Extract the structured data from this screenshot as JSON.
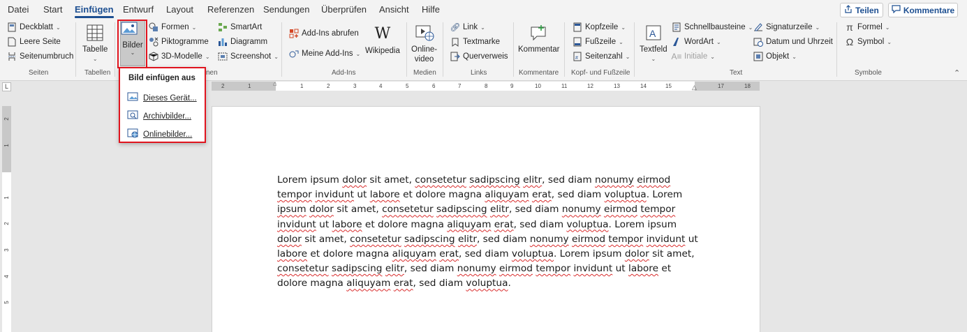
{
  "tabs": [
    "Datei",
    "Start",
    "Einfügen",
    "Entwurf",
    "Layout",
    "Referenzen",
    "Sendungen",
    "Überprüfen",
    "Ansicht",
    "Hilfe"
  ],
  "active_tab": "Einfügen",
  "share_label": "Teilen",
  "comments_label": "Kommentare",
  "ribbon": {
    "seiten": {
      "deckblatt": "Deckblatt",
      "leere_seite": "Leere Seite",
      "seitenumbruch": "Seitenumbruch",
      "group": "Seiten"
    },
    "tabellen": {
      "tabelle": "Tabelle",
      "group": "Tabellen"
    },
    "illustrationen": {
      "bilder": "Bilder",
      "formen": "Formen",
      "piktogramme": "Piktogramme",
      "modelle_3d": "3D-Modelle",
      "smartart": "SmartArt",
      "diagramm": "Diagramm",
      "screenshot": "Screenshot",
      "group_partial": "nen"
    },
    "addins": {
      "abrufen": "Add-Ins abrufen",
      "meine": "Meine Add-Ins",
      "wikipedia": "Wikipedia",
      "group": "Add-Ins"
    },
    "medien": {
      "onlinevideo_1": "Online-",
      "onlinevideo_2": "video",
      "group": "Medien"
    },
    "links": {
      "link": "Link",
      "textmarke": "Textmarke",
      "querverweis": "Querverweis",
      "group": "Links"
    },
    "kommentare": {
      "kommentar": "Kommentar",
      "group": "Kommentare"
    },
    "kopf": {
      "kopfzeile": "Kopfzeile",
      "fusszeile": "Fußzeile",
      "seitenzahl": "Seitenzahl",
      "group": "Kopf- und Fußzeile"
    },
    "text": {
      "textfeld": "Textfeld",
      "schnellbausteine": "Schnellbausteine",
      "wordart": "WordArt",
      "initiale": "Initiale",
      "signaturzeile": "Signaturzeile",
      "datum": "Datum und Uhrzeit",
      "objekt": "Objekt",
      "group": "Text"
    },
    "symbole": {
      "formel": "Formel",
      "symbol": "Symbol",
      "group": "Symbole"
    }
  },
  "dropdown": {
    "title": "Bild einfügen aus",
    "items": [
      {
        "label": "Dieses Gerät...",
        "icon": "device-image-icon"
      },
      {
        "label": "Archivbilder...",
        "icon": "stock-image-icon"
      },
      {
        "label": "Onlinebilder...",
        "icon": "online-image-icon"
      }
    ]
  },
  "ruler": {
    "h_ticks": [
      "2",
      "1",
      "1",
      "2",
      "3",
      "4",
      "5",
      "6",
      "7",
      "8",
      "9",
      "10",
      "11",
      "12",
      "13",
      "14",
      "15",
      "17",
      "18"
    ],
    "v_ticks": [
      "2",
      "1",
      "1",
      "2",
      "3",
      "4",
      "5"
    ],
    "corner": "L"
  },
  "document": {
    "lines": [
      [
        "Lorem ipsum ",
        "~dolor",
        " sit amet, ",
        "~consetetur",
        " ",
        "~sadipscing",
        " ",
        "~elitr",
        ", sed diam ",
        "~nonumy",
        " ",
        "~eirmod"
      ],
      [
        "~tempor",
        " ",
        "~invidunt",
        " ut ",
        "~labore",
        " et dolore magna ",
        "~aliquyam",
        " ",
        "~erat",
        ", sed diam ",
        "~voluptua",
        ". Lorem"
      ],
      [
        "~ipsum",
        " ",
        "~dolor",
        " sit amet, ",
        "~consetetur",
        " ",
        "~sadipscing",
        " ",
        "~elitr",
        ", sed diam ",
        "~nonumy",
        " ",
        "~eirmod",
        " ",
        "~tempor"
      ],
      [
        "~invidunt",
        " ut ",
        "~labore",
        " et dolore magna ",
        "~aliquyam",
        " ",
        "~erat",
        ", sed diam ",
        "~voluptua",
        ". Lorem ipsum"
      ],
      [
        "~dolor",
        " sit amet, ",
        "~consetetur",
        " ",
        "~sadipscing",
        " ",
        "~elitr",
        ", sed diam ",
        "~nonumy",
        " ",
        "~eirmod",
        " ",
        "~tempor",
        " ",
        "~invidunt",
        " ut"
      ],
      [
        "~labore",
        " et dolore magna ",
        "~aliquyam",
        " ",
        "~erat",
        ", sed diam ",
        "~voluptua",
        ". Lorem ipsum ",
        "~dolor",
        " sit amet,"
      ],
      [
        "~consetetur",
        " ",
        "~sadipscing",
        " ",
        "~elitr",
        ", sed diam ",
        "~nonumy",
        " ",
        "~eirmod",
        " ",
        "~tempor",
        " ",
        "~invidunt",
        " ut ",
        "~labore",
        " et"
      ],
      [
        "dolore magna ",
        "~aliquyam",
        " ",
        "~erat",
        ", sed diam ",
        "~voluptua",
        "."
      ]
    ]
  },
  "colors": {
    "accent": "#1d4f91",
    "highlight": "#e0141e",
    "spell_error": "#d92b2b"
  }
}
